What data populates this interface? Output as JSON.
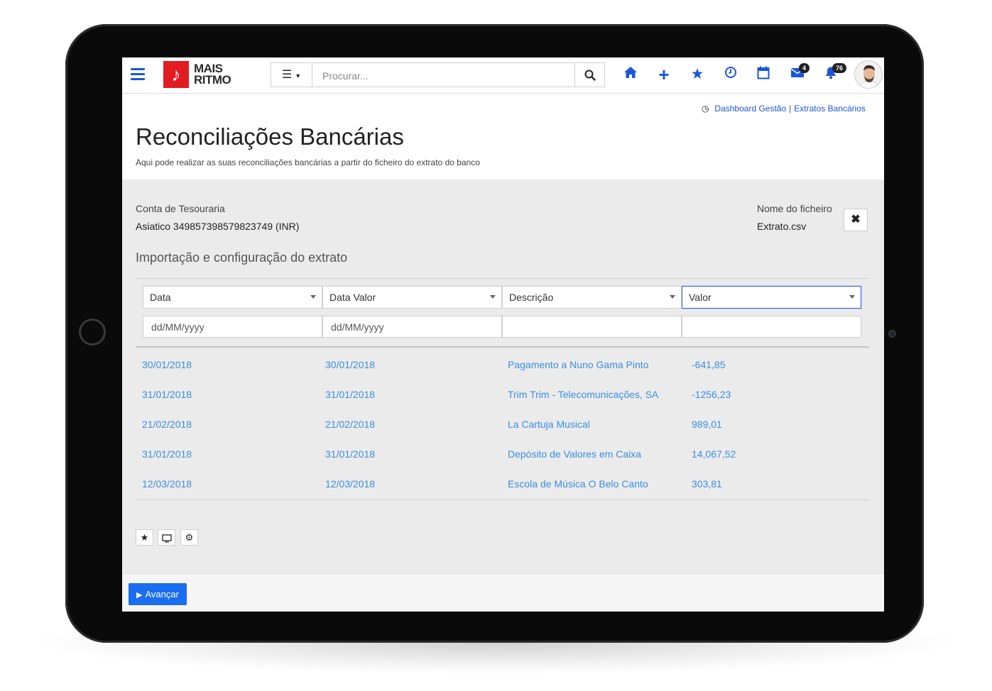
{
  "app": {
    "logo_line1": "MAIS",
    "logo_line2": "RITMO",
    "logo_glyph": "♪"
  },
  "search": {
    "placeholder": "Procurar..."
  },
  "topbar": {
    "icons": [
      "home-icon",
      "plus-icon",
      "star-icon",
      "clock-icon",
      "calendar-icon",
      "envelope-icon",
      "bell-icon"
    ],
    "messages_badge": "4",
    "notifications_badge": "76"
  },
  "breadcrumb": {
    "items": [
      "Dashboard Gestão",
      "Extratos Bancários"
    ]
  },
  "page": {
    "title": "Reconciliações Bancárias",
    "subtitle": "Aqui pode realizar as suas reconciliações bancárias a partir do ficheiro do extrato do banco"
  },
  "account": {
    "label": "Conta de Tesouraria",
    "value": "Asiatico 349857398579823749 (INR)"
  },
  "file": {
    "label": "Nome do ficheiro",
    "value": "Extrato.csv"
  },
  "section": {
    "title": "Importação e configuração do extrato"
  },
  "columns": [
    {
      "label": "Data",
      "format": "dd/MM/yyyy"
    },
    {
      "label": "Data Valor",
      "format": "dd/MM/yyyy"
    },
    {
      "label": "Descrição",
      "format": ""
    },
    {
      "label": "Valor",
      "format": ""
    }
  ],
  "rows": [
    [
      "30/01/2018",
      "30/01/2018",
      "Pagamento a Nuno Gama Pinto",
      "-641,85"
    ],
    [
      "31/01/2018",
      "31/01/2018",
      "Trim Trim - Telecomunicações, SA",
      "-1256,23"
    ],
    [
      "21/02/2018",
      "21/02/2018",
      "La Cartuja Musical",
      "989,01"
    ],
    [
      "31/01/2018",
      "31/01/2018",
      "Depósito de Valores em Caixa",
      "14,067,52"
    ],
    [
      "12/03/2018",
      "12/03/2018",
      "Escola de Música O Belo Canto",
      "303,81"
    ]
  ],
  "footer": {
    "advance_label": "Avançar"
  },
  "colors": {
    "accent": "#1a56db",
    "link": "#3a8ee6",
    "brand_red": "#e31b23",
    "button": "#1a6cf0"
  }
}
